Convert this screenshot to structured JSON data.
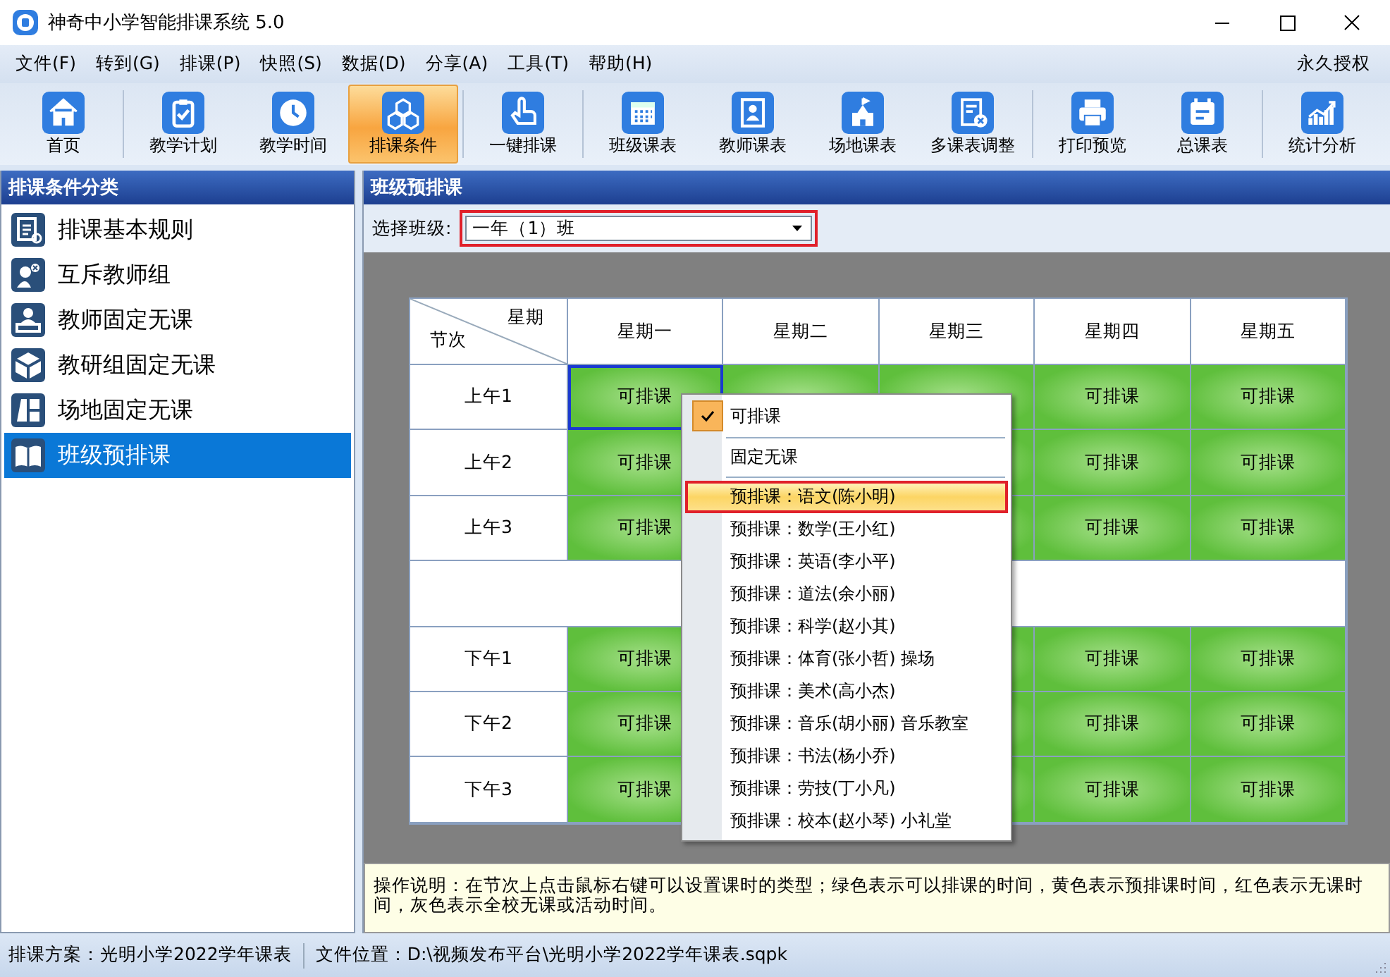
{
  "window": {
    "title": "神奇中小学智能排课系统 5.0"
  },
  "menu": [
    "文件(F)",
    "转到(G)",
    "排课(P)",
    "快照(S)",
    "数据(D)",
    "分享(A)",
    "工具(T)",
    "帮助(H)"
  ],
  "license": "永久授权",
  "toolbar": [
    [
      {
        "label": "首页",
        "selected": false
      }
    ],
    [
      {
        "label": "教学计划",
        "selected": false
      },
      {
        "label": "教学时间",
        "selected": false
      },
      {
        "label": "排课条件",
        "selected": true
      }
    ],
    [
      {
        "label": "一键排课",
        "selected": false
      }
    ],
    [
      {
        "label": "班级课表",
        "selected": false
      },
      {
        "label": "教师课表",
        "selected": false
      },
      {
        "label": "场地课表",
        "selected": false
      },
      {
        "label": "多课表调整",
        "selected": false
      }
    ],
    [
      {
        "label": "打印预览",
        "selected": false
      },
      {
        "label": "总课表",
        "selected": false
      }
    ],
    [
      {
        "label": "统计分析",
        "selected": false
      }
    ]
  ],
  "sidebar": {
    "title": "排课条件分类",
    "items": [
      {
        "label": "排课基本规则",
        "selected": false
      },
      {
        "label": "互斥教师组",
        "selected": false
      },
      {
        "label": "教师固定无课",
        "selected": false
      },
      {
        "label": "教研组固定无课",
        "selected": false
      },
      {
        "label": "场地固定无课",
        "selected": false
      },
      {
        "label": "班级预排课",
        "selected": true
      }
    ]
  },
  "panel": {
    "title": "班级预排课",
    "class_label": "选择班级:",
    "class_value": "一年（1）班",
    "class_highlighted": true
  },
  "grid": {
    "corner_top": "星期",
    "corner_bottom": "节次",
    "columns": [
      "星期一",
      "星期二",
      "星期三",
      "星期四",
      "星期五"
    ],
    "rows": [
      {
        "kind": "lesson",
        "label": "上午1",
        "cells": [
          {
            "kind": "available",
            "selected": true,
            "text": "可排课"
          },
          {
            "kind": "available",
            "selected": false
          },
          {
            "kind": "available",
            "selected": false
          },
          {
            "kind": "available",
            "selected": false,
            "text": "可排课"
          },
          {
            "kind": "available",
            "selected": false,
            "text": "可排课"
          }
        ]
      },
      {
        "kind": "lesson",
        "label": "上午2",
        "cells": [
          {
            "kind": "available",
            "selected": false,
            "text": "可排课"
          },
          null,
          {
            "kind": "available"
          },
          {
            "kind": "available",
            "selected": false,
            "text": "可排课"
          },
          {
            "kind": "available",
            "selected": false,
            "text": "可排课"
          }
        ]
      },
      {
        "kind": "lesson",
        "label": "上午3",
        "cells": [
          {
            "kind": "available",
            "selected": false,
            "text": "可排课"
          },
          null,
          {
            "kind": "available"
          },
          {
            "kind": "available",
            "selected": false,
            "text": "可排课"
          },
          {
            "kind": "available",
            "selected": false,
            "text": "可排课"
          }
        ]
      },
      {
        "kind": "break"
      },
      {
        "kind": "lesson",
        "label": "下午1",
        "cells": [
          {
            "kind": "available",
            "selected": false,
            "text": "可排课"
          },
          null,
          {
            "kind": "available"
          },
          {
            "kind": "available",
            "selected": false,
            "text": "可排课"
          },
          {
            "kind": "available",
            "selected": false,
            "text": "可排课"
          }
        ]
      },
      {
        "kind": "lesson",
        "label": "下午2",
        "cells": [
          {
            "kind": "available",
            "selected": false,
            "text": "可排课"
          },
          null,
          {
            "kind": "available"
          },
          {
            "kind": "available",
            "selected": false,
            "text": "可排课"
          },
          {
            "kind": "available",
            "selected": false,
            "text": "可排课"
          }
        ]
      },
      {
        "kind": "lesson",
        "label": "下午3",
        "cells": [
          {
            "kind": "available",
            "selected": false,
            "text": "可排课"
          },
          null,
          {
            "kind": "available"
          },
          {
            "kind": "available",
            "selected": false,
            "text": "可排课"
          },
          {
            "kind": "available",
            "selected": false,
            "text": "可排课"
          }
        ]
      }
    ]
  },
  "context_menu": [
    [
      {
        "label": "可排课",
        "checked": true,
        "highlighted": false
      }
    ],
    [
      {
        "label": "固定无课",
        "checked": false,
        "highlighted": false
      }
    ],
    [
      {
        "label": "预排课：语文(陈小明)",
        "checked": false,
        "highlighted": true
      },
      {
        "label": "预排课：数学(王小红)",
        "checked": false,
        "highlighted": false
      },
      {
        "label": "预排课：英语(李小平)",
        "checked": false,
        "highlighted": false
      },
      {
        "label": "预排课：道法(余小丽)",
        "checked": false,
        "highlighted": false
      },
      {
        "label": "预排课：科学(赵小其)",
        "checked": false,
        "highlighted": false
      },
      {
        "label": "预排课：体育(张小哲) 操场",
        "checked": false,
        "highlighted": false
      },
      {
        "label": "预排课：美术(高小杰)",
        "checked": false,
        "highlighted": false
      },
      {
        "label": "预排课：音乐(胡小丽) 音乐教室",
        "checked": false,
        "highlighted": false
      },
      {
        "label": "预排课：书法(杨小乔)",
        "checked": false,
        "highlighted": false
      },
      {
        "label": "预排课：劳技(丁小凡)",
        "checked": false,
        "highlighted": false
      },
      {
        "label": "预排课：校本(赵小琴) 小礼堂",
        "checked": false,
        "highlighted": false
      }
    ]
  ],
  "instructions": "操作说明：在节次上点击鼠标右键可以设置课时的类型；绿色表示可以排课的时间，黄色表示预排课时间，红色表示无课时间，灰色表示全校无课或活动时间。",
  "status_bar": [
    "排课方案：光明小学2022学年课表",
    "文件位置：D:\\视频发布平台\\光明小学2022学年课表.sqpk"
  ]
}
